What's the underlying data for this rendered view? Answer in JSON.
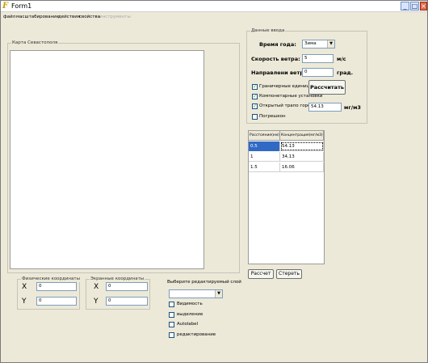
{
  "window": {
    "title": "Form1",
    "icon": "app-icon",
    "controls": {
      "minimize": "_",
      "maximize": "□",
      "close": "×"
    }
  },
  "menu": [
    {
      "label": "файл",
      "enabled": true
    },
    {
      "label": "масштабирование",
      "enabled": true
    },
    {
      "label": "действия",
      "enabled": true
    },
    {
      "label": "свойства",
      "enabled": true
    },
    {
      "label": "инструменты",
      "enabled": false
    }
  ],
  "map_panel": {
    "label": "Карта Севастополя"
  },
  "input_panel": {
    "label": "Данные ввода",
    "season_label": "Время года:",
    "season_value": "Зима",
    "wind_speed_label": "Скорость ветра:",
    "wind_speed_value": "5",
    "wind_speed_unit": "м/с",
    "wind_dir_label": "Направлени ветра:",
    "wind_dir_value": "0",
    "wind_dir_unit": "град.",
    "checks": [
      {
        "label": "Граничерные единицы",
        "checked": true
      },
      {
        "label": "Компонетарные установки",
        "checked": true
      },
      {
        "label": "Открытый трапо города",
        "checked": true
      },
      {
        "label": "Погрешеон",
        "checked": false
      }
    ],
    "calculate_button": "Рассчитать",
    "concentration_value": "54.13",
    "concentration_unit": "мг/м3"
  },
  "results_table": {
    "headers": [
      "Расстояние(км)",
      "Концентрация(мг/м3)"
    ],
    "rows": [
      [
        "0.5",
        "54.13"
      ],
      [
        "1",
        "34,13"
      ],
      [
        "1.5",
        "16.06"
      ]
    ]
  },
  "actions": {
    "calc_button": "Рассчет",
    "clear_button": "Стереть"
  },
  "physical_coords": {
    "label": "Физические координаты",
    "x_label": "X",
    "x_value": "0",
    "y_label": "Y",
    "y_value": "0"
  },
  "screen_coords": {
    "label": "Экранные координаты",
    "x_label": "X",
    "x_value": "0",
    "y_label": "Y",
    "y_value": "0"
  },
  "layers": {
    "label": "Выберите редактируемый слой",
    "combo_value": "",
    "options": [
      {
        "label": "Видимость",
        "checked": false
      },
      {
        "label": "выделение",
        "checked": false
      },
      {
        "label": "Autolabel",
        "checked": false
      },
      {
        "label": "редактирование",
        "checked": false
      }
    ]
  }
}
